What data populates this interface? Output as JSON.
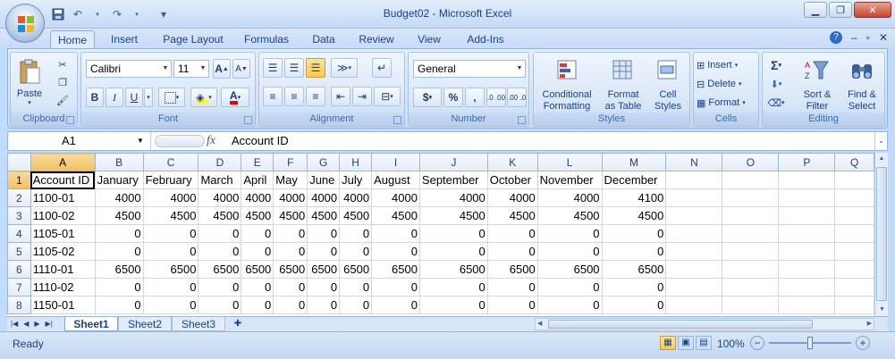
{
  "window": {
    "title": "Budget02 - Microsoft Excel",
    "minimize": "▁",
    "restore": "❐",
    "close": "✕"
  },
  "qat": {
    "save_icon": "save-icon",
    "undo": "↶",
    "redo": "↷",
    "customize": "▾"
  },
  "tabs": [
    {
      "label": "Home"
    },
    {
      "label": "Insert"
    },
    {
      "label": "Page Layout"
    },
    {
      "label": "Formulas"
    },
    {
      "label": "Data"
    },
    {
      "label": "Review"
    },
    {
      "label": "View"
    },
    {
      "label": "Add-Ins"
    }
  ],
  "ribbon_right": {
    "help": "?",
    "min": "–",
    "restore": "▫",
    "close": "✕"
  },
  "clipboard": {
    "label": "Clipboard",
    "paste": "Paste"
  },
  "font": {
    "label": "Font",
    "name": "Calibri",
    "size": "11",
    "grow": "A",
    "shrink": "A",
    "bold": "B",
    "italic": "I",
    "underline": "U",
    "font_color_label": "A"
  },
  "alignment": {
    "label": "Alignment"
  },
  "number": {
    "label": "Number",
    "format": "General",
    "currency": "$",
    "percent": "%",
    "comma": ",",
    "inc_dec": ".0 .00",
    "dec_dec": ".00 .0"
  },
  "styles": {
    "label": "Styles",
    "conditional": "Conditional",
    "conditional2": "Formatting",
    "format_table": "Format",
    "format_table2": "as Table",
    "cell_styles": "Cell",
    "cell_styles2": "Styles"
  },
  "cells": {
    "label": "Cells",
    "insert": "Insert",
    "delete": "Delete",
    "format": "Format"
  },
  "editing": {
    "label": "Editing",
    "sigma": "Σ",
    "sort": "Sort &",
    "sort2": "Filter",
    "find": "Find &",
    "find2": "Select"
  },
  "formula_bar": {
    "name_box": "A1",
    "fx": "fx",
    "value": "Account ID"
  },
  "grid": {
    "columns": [
      "A",
      "B",
      "C",
      "D",
      "E",
      "F",
      "G",
      "H",
      "I",
      "J",
      "K",
      "L",
      "M",
      "N",
      "O",
      "P",
      "Q"
    ],
    "rows": [
      {
        "n": "1",
        "cells": [
          "Account ID",
          "January",
          "February",
          "March",
          "April",
          "May",
          "June",
          "July",
          "August",
          "September",
          "October",
          "November",
          "December",
          "",
          "",
          "",
          ""
        ]
      },
      {
        "n": "2",
        "cells": [
          "1100-01",
          "4000",
          "4000",
          "4000",
          "4000",
          "4000",
          "4000",
          "4000",
          "4000",
          "4000",
          "4000",
          "4000",
          "4100",
          "",
          "",
          "",
          ""
        ]
      },
      {
        "n": "3",
        "cells": [
          "1100-02",
          "4500",
          "4500",
          "4500",
          "4500",
          "4500",
          "4500",
          "4500",
          "4500",
          "4500",
          "4500",
          "4500",
          "4500",
          "",
          "",
          "",
          ""
        ]
      },
      {
        "n": "4",
        "cells": [
          "1105-01",
          "0",
          "0",
          "0",
          "0",
          "0",
          "0",
          "0",
          "0",
          "0",
          "0",
          "0",
          "0",
          "",
          "",
          "",
          ""
        ]
      },
      {
        "n": "5",
        "cells": [
          "1105-02",
          "0",
          "0",
          "0",
          "0",
          "0",
          "0",
          "0",
          "0",
          "0",
          "0",
          "0",
          "0",
          "",
          "",
          "",
          ""
        ]
      },
      {
        "n": "6",
        "cells": [
          "1110-01",
          "6500",
          "6500",
          "6500",
          "6500",
          "6500",
          "6500",
          "6500",
          "6500",
          "6500",
          "6500",
          "6500",
          "6500",
          "",
          "",
          "",
          ""
        ]
      },
      {
        "n": "7",
        "cells": [
          "1110-02",
          "0",
          "0",
          "0",
          "0",
          "0",
          "0",
          "0",
          "0",
          "0",
          "0",
          "0",
          "0",
          "",
          "",
          "",
          ""
        ]
      },
      {
        "n": "8",
        "cells": [
          "1150-01",
          "0",
          "0",
          "0",
          "0",
          "0",
          "0",
          "0",
          "0",
          "0",
          "0",
          "0",
          "0",
          "",
          "",
          "",
          ""
        ]
      }
    ]
  },
  "sheet_tabs": [
    {
      "label": "Sheet1"
    },
    {
      "label": "Sheet2"
    },
    {
      "label": "Sheet3"
    }
  ],
  "status": {
    "ready": "Ready",
    "zoom": "100%",
    "zoom_out": "−",
    "zoom_in": "+"
  }
}
